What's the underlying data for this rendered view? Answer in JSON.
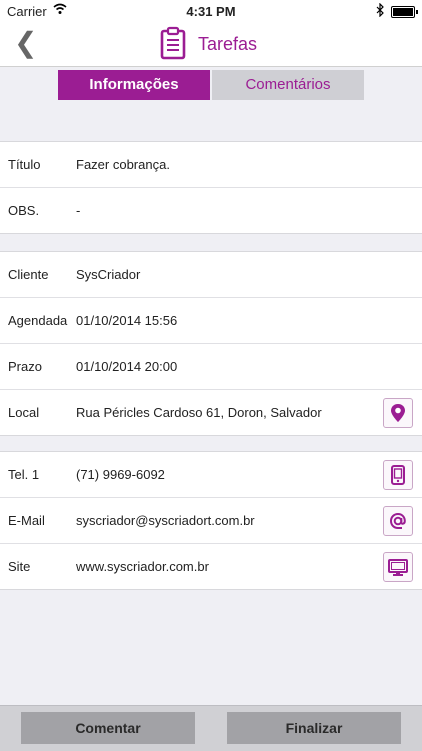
{
  "status_bar": {
    "carrier": "Carrier",
    "time": "4:31 PM",
    "battery_level": 1.0
  },
  "nav": {
    "back_icon": "chevron-left-icon",
    "title": "Tarefas",
    "title_icon": "clipboard-icon"
  },
  "tabs": [
    {
      "label": "Informações",
      "active": true
    },
    {
      "label": "Comentários",
      "active": false
    }
  ],
  "details": {
    "titulo": {
      "label": "Título",
      "value": "Fazer cobrança."
    },
    "obs": {
      "label": "OBS.",
      "value": "-"
    },
    "cliente": {
      "label": "Cliente",
      "value": "SysCriador"
    },
    "agendada": {
      "label": "Agendada",
      "value": "01/10/2014 15:56"
    },
    "prazo": {
      "label": "Prazo",
      "value": "01/10/2014 20:00"
    },
    "local": {
      "label": "Local",
      "value": "Rua Péricles Cardoso 61, Doron, Salvador",
      "icon": "map-pin-icon"
    },
    "tel": {
      "label": "Tel. 1",
      "value": "(71) 9969-6092",
      "icon": "phone-icon"
    },
    "email": {
      "label": "E-Mail",
      "value": "syscriador@syscriadort.com.br",
      "icon": "at-icon"
    },
    "site": {
      "label": "Site",
      "value": "www.syscriador.com.br",
      "icon": "monitor-icon"
    }
  },
  "bottom": {
    "comentar": "Comentar",
    "finalizar": "Finalizar"
  },
  "colors": {
    "accent": "#9b1d93",
    "tab_inactive": "#cfcfd4",
    "bottom_button": "#a2a2a6"
  }
}
